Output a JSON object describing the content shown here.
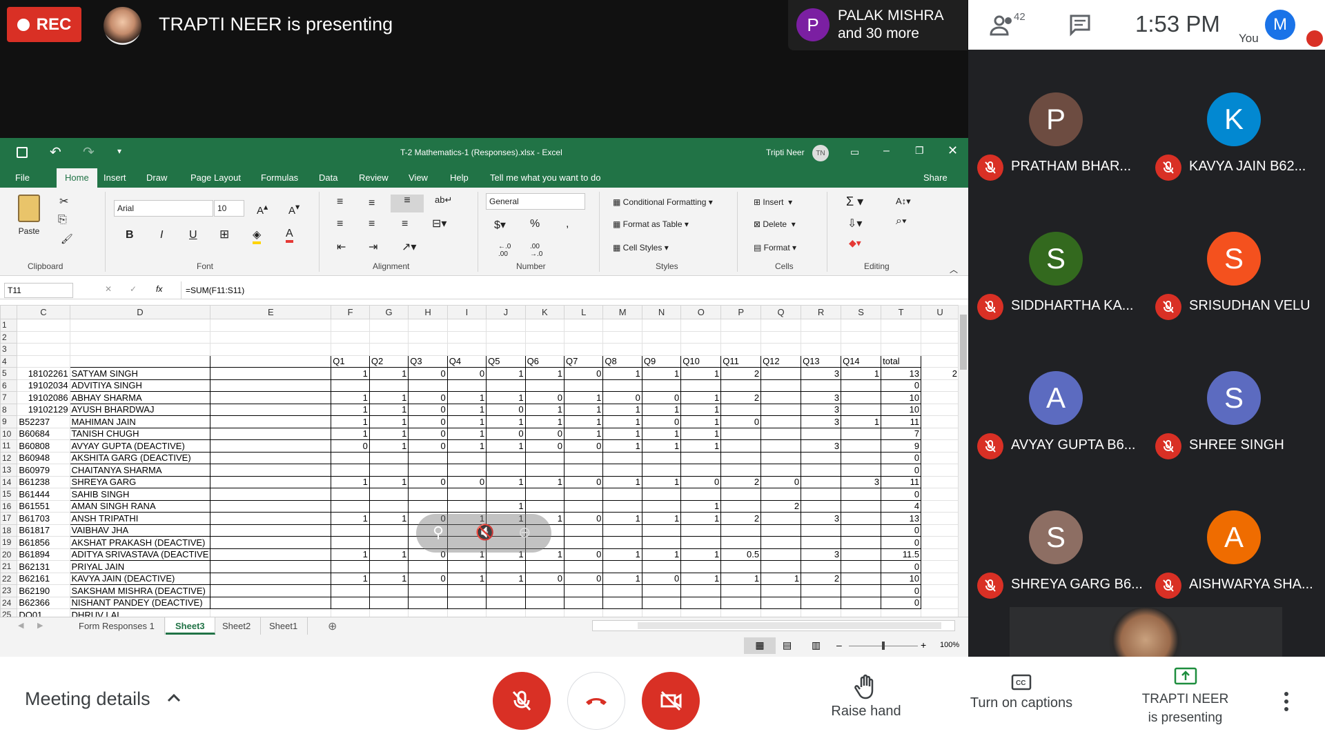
{
  "topbar": {
    "rec_label": "REC",
    "presenting_text": "TRAPTI NEER is presenting",
    "others_initial": "P",
    "others_line1": "PALAK MISHRA",
    "others_line2": "and 30 more"
  },
  "rightbar": {
    "people_count": "42",
    "time": "1:53 PM",
    "you_label": "You",
    "you_initial": "M"
  },
  "participants": [
    {
      "initial": "P",
      "name": "PRATHAM BHAR...",
      "color": "#6d4c41"
    },
    {
      "initial": "K",
      "name": "KAVYA JAIN B62...",
      "color": "#0288d1"
    },
    {
      "initial": "S",
      "name": "SIDDHARTHA KA...",
      "color": "#33691e"
    },
    {
      "initial": "S",
      "name": "SRISUDHAN VELU",
      "color": "#f4511e"
    },
    {
      "initial": "A",
      "name": "AVYAY GUPTA B6...",
      "color": "#5c6bc0"
    },
    {
      "initial": "S",
      "name": "SHREE SINGH",
      "color": "#5c6bc0"
    },
    {
      "initial": "S",
      "name": "SHREYA GARG B6...",
      "color": "#8d6e63"
    },
    {
      "initial": "A",
      "name": "AISHWARYA SHA...",
      "color": "#ef6c00"
    }
  ],
  "excel": {
    "title": "T-2 Mathematics-1 (Responses).xlsx  -  Excel",
    "user": "Tripti Neer",
    "user_initials": "TN",
    "tabs": [
      "File",
      "Home",
      "Insert",
      "Draw",
      "Page Layout",
      "Formulas",
      "Data",
      "Review",
      "View",
      "Help"
    ],
    "tell_me": "Tell me what you want to do",
    "share": "Share",
    "ribbon": {
      "paste": "Paste",
      "font_name": "Arial",
      "font_size": "10",
      "number_format": "General",
      "cond_format": "Conditional Formatting",
      "format_table": "Format as Table",
      "cell_styles": "Cell Styles",
      "insert": "Insert",
      "delete": "Delete",
      "format": "Format",
      "groups": [
        "Clipboard",
        "Font",
        "Alignment",
        "Number",
        "Styles",
        "Cells",
        "Editing"
      ]
    },
    "name_box": "T11",
    "formula": "=SUM(F11:S11)",
    "columns": [
      "C",
      "D",
      "E",
      "F",
      "G",
      "H",
      "I",
      "J",
      "K",
      "L",
      "M",
      "N",
      "O",
      "P",
      "Q",
      "R",
      "S",
      "T",
      "U"
    ],
    "header_row": [
      "",
      "",
      "",
      "Q1",
      "Q2",
      "Q3",
      "Q4",
      "Q5",
      "Q6",
      "Q7",
      "Q8",
      "Q9",
      "Q10",
      "Q11",
      "Q12",
      "Q13",
      "Q14",
      "total",
      ""
    ],
    "rows": [
      {
        "n": "1",
        "cells": []
      },
      {
        "n": "2",
        "cells": []
      },
      {
        "n": "3",
        "cells": []
      },
      {
        "n": "4",
        "cells": "header"
      },
      {
        "n": "5",
        "cells": [
          "18102261",
          "SATYAM  SINGH",
          "",
          "1",
          "1",
          "0",
          "0",
          "1",
          "1",
          "0",
          "1",
          "1",
          "1",
          "2",
          "",
          "3",
          "1",
          "13",
          "2"
        ]
      },
      {
        "n": "6",
        "cells": [
          "19102034",
          "ADVITIYA  SINGH",
          "",
          "",
          "",
          "",
          "",
          "",
          "",
          "",
          "",
          "",
          "",
          "",
          "",
          "",
          "",
          "0",
          ""
        ]
      },
      {
        "n": "7",
        "cells": [
          "19102086",
          "ABHAY  SHARMA",
          "",
          "1",
          "1",
          "0",
          "1",
          "1",
          "0",
          "1",
          "0",
          "0",
          "1",
          "2",
          "",
          "3",
          "",
          "10",
          ""
        ]
      },
      {
        "n": "8",
        "cells": [
          "19102129",
          "AYUSH  BHARDWAJ",
          "",
          "1",
          "1",
          "0",
          "1",
          "0",
          "1",
          "1",
          "1",
          "1",
          "1",
          "",
          "",
          "3",
          "",
          "10",
          ""
        ]
      },
      {
        "n": "9",
        "cells": [
          "B52237",
          "MAHIMAN  JAIN",
          "",
          "1",
          "1",
          "0",
          "1",
          "1",
          "1",
          "1",
          "1",
          "0",
          "1",
          "0",
          "",
          "3",
          "1",
          "11",
          ""
        ]
      },
      {
        "n": "10",
        "cells": [
          "B60684",
          "TANISH  CHUGH",
          "",
          "1",
          "1",
          "0",
          "1",
          "0",
          "0",
          "1",
          "1",
          "1",
          "1",
          "",
          "",
          "",
          "",
          "7",
          ""
        ]
      },
      {
        "n": "11",
        "cells": [
          "B60808",
          "AVYAY  GUPTA (DEACTIVE)",
          "",
          "0",
          "1",
          "0",
          "1",
          "1",
          "0",
          "0",
          "1",
          "1",
          "1",
          "",
          "",
          "3",
          "",
          "9",
          ""
        ]
      },
      {
        "n": "12",
        "cells": [
          "B60948",
          "AKSHITA  GARG (DEACTIVE)",
          "",
          "",
          "",
          "",
          "",
          "",
          "",
          "",
          "",
          "",
          "",
          "",
          "",
          "",
          "",
          "0",
          ""
        ]
      },
      {
        "n": "13",
        "cells": [
          "B60979",
          "CHAITANYA  SHARMA",
          "",
          "",
          "",
          "",
          "",
          "",
          "",
          "",
          "",
          "",
          "",
          "",
          "",
          "",
          "",
          "0",
          ""
        ]
      },
      {
        "n": "14",
        "cells": [
          "B61238",
          "SHREYA  GARG",
          "",
          "1",
          "1",
          "0",
          "0",
          "1",
          "1",
          "0",
          "1",
          "1",
          "0",
          "2",
          "0",
          "",
          "3",
          "11",
          ""
        ]
      },
      {
        "n": "15",
        "cells": [
          "B61444",
          "SAHIB  SINGH",
          "",
          "",
          "",
          "",
          "",
          "",
          "",
          "",
          "",
          "",
          "",
          "",
          "",
          "",
          "",
          "0",
          ""
        ]
      },
      {
        "n": "16",
        "cells": [
          "B61551",
          "AMAN SINGH RANA",
          "",
          "",
          "",
          "",
          "",
          "1",
          "",
          "",
          "",
          "",
          "1",
          "",
          "2",
          "",
          "",
          "4",
          ""
        ]
      },
      {
        "n": "17",
        "cells": [
          "B61703",
          "ANSH  TRIPATHI",
          "",
          "1",
          "1",
          "0",
          "1",
          "1",
          "1",
          "0",
          "1",
          "1",
          "1",
          "2",
          "",
          "3",
          "",
          "13",
          ""
        ]
      },
      {
        "n": "18",
        "cells": [
          "B61817",
          "VAIBHAV  JHA",
          "",
          "",
          "",
          "",
          "",
          "",
          "",
          "",
          "",
          "",
          "",
          "",
          "",
          "",
          "",
          "0",
          ""
        ]
      },
      {
        "n": "19",
        "cells": [
          "B61856",
          "AKSHAT  PRAKASH (DEACTIVE)",
          "",
          "",
          "",
          "",
          "",
          "",
          "",
          "",
          "",
          "",
          "",
          "",
          "",
          "",
          "",
          "0",
          ""
        ]
      },
      {
        "n": "20",
        "cells": [
          "B61894",
          "ADITYA  SRIVASTAVA (DEACTIVE",
          "",
          "1",
          "1",
          "0",
          "1",
          "1",
          "1",
          "0",
          "1",
          "1",
          "1",
          "0.5",
          "",
          "3",
          "",
          "11.5",
          ""
        ]
      },
      {
        "n": "21",
        "cells": [
          "B62131",
          "PRIYAL  JAIN",
          "",
          "",
          "",
          "",
          "",
          "",
          "",
          "",
          "",
          "",
          "",
          "",
          "",
          "",
          "",
          "0",
          ""
        ]
      },
      {
        "n": "22",
        "cells": [
          "B62161",
          "KAVYA  JAIN (DEACTIVE)",
          "",
          "1",
          "1",
          "0",
          "1",
          "1",
          "0",
          "0",
          "1",
          "0",
          "1",
          "1",
          "1",
          "2",
          "",
          "10",
          ""
        ]
      },
      {
        "n": "23",
        "cells": [
          "B62190",
          "SAKSHAM  MISHRA (DEACTIVE)",
          "",
          "",
          "",
          "",
          "",
          "",
          "",
          "",
          "",
          "",
          "",
          "",
          "",
          "",
          "",
          "0",
          ""
        ]
      },
      {
        "n": "24",
        "cells": [
          "B62366",
          "NISHANT  PANDEY (DEACTIVE)",
          "",
          "",
          "",
          "",
          "",
          "",
          "",
          "",
          "",
          "",
          "",
          "",
          "",
          "",
          "",
          "0",
          ""
        ]
      },
      {
        "n": "25",
        "cells": [
          "DO01",
          "DHRUV LAL",
          "",
          "",
          "",
          "",
          "",
          "",
          "",
          "",
          "",
          "",
          "",
          "",
          "",
          "",
          "",
          "",
          ""
        ]
      }
    ],
    "sheet_tabs": [
      "Form Responses 1",
      "Sheet3",
      "Sheet2",
      "Sheet1"
    ],
    "active_sheet": "Sheet3",
    "zoom": "100%"
  },
  "bottom": {
    "meeting_details": "Meeting details",
    "raise_hand": "Raise hand",
    "captions": "Turn on captions",
    "presenting_line1": "TRAPTI NEER",
    "presenting_line2": "is presenting"
  },
  "colors": {
    "excel_green": "#217346",
    "meet_red": "#d93025",
    "dark_bg": "#202124"
  }
}
